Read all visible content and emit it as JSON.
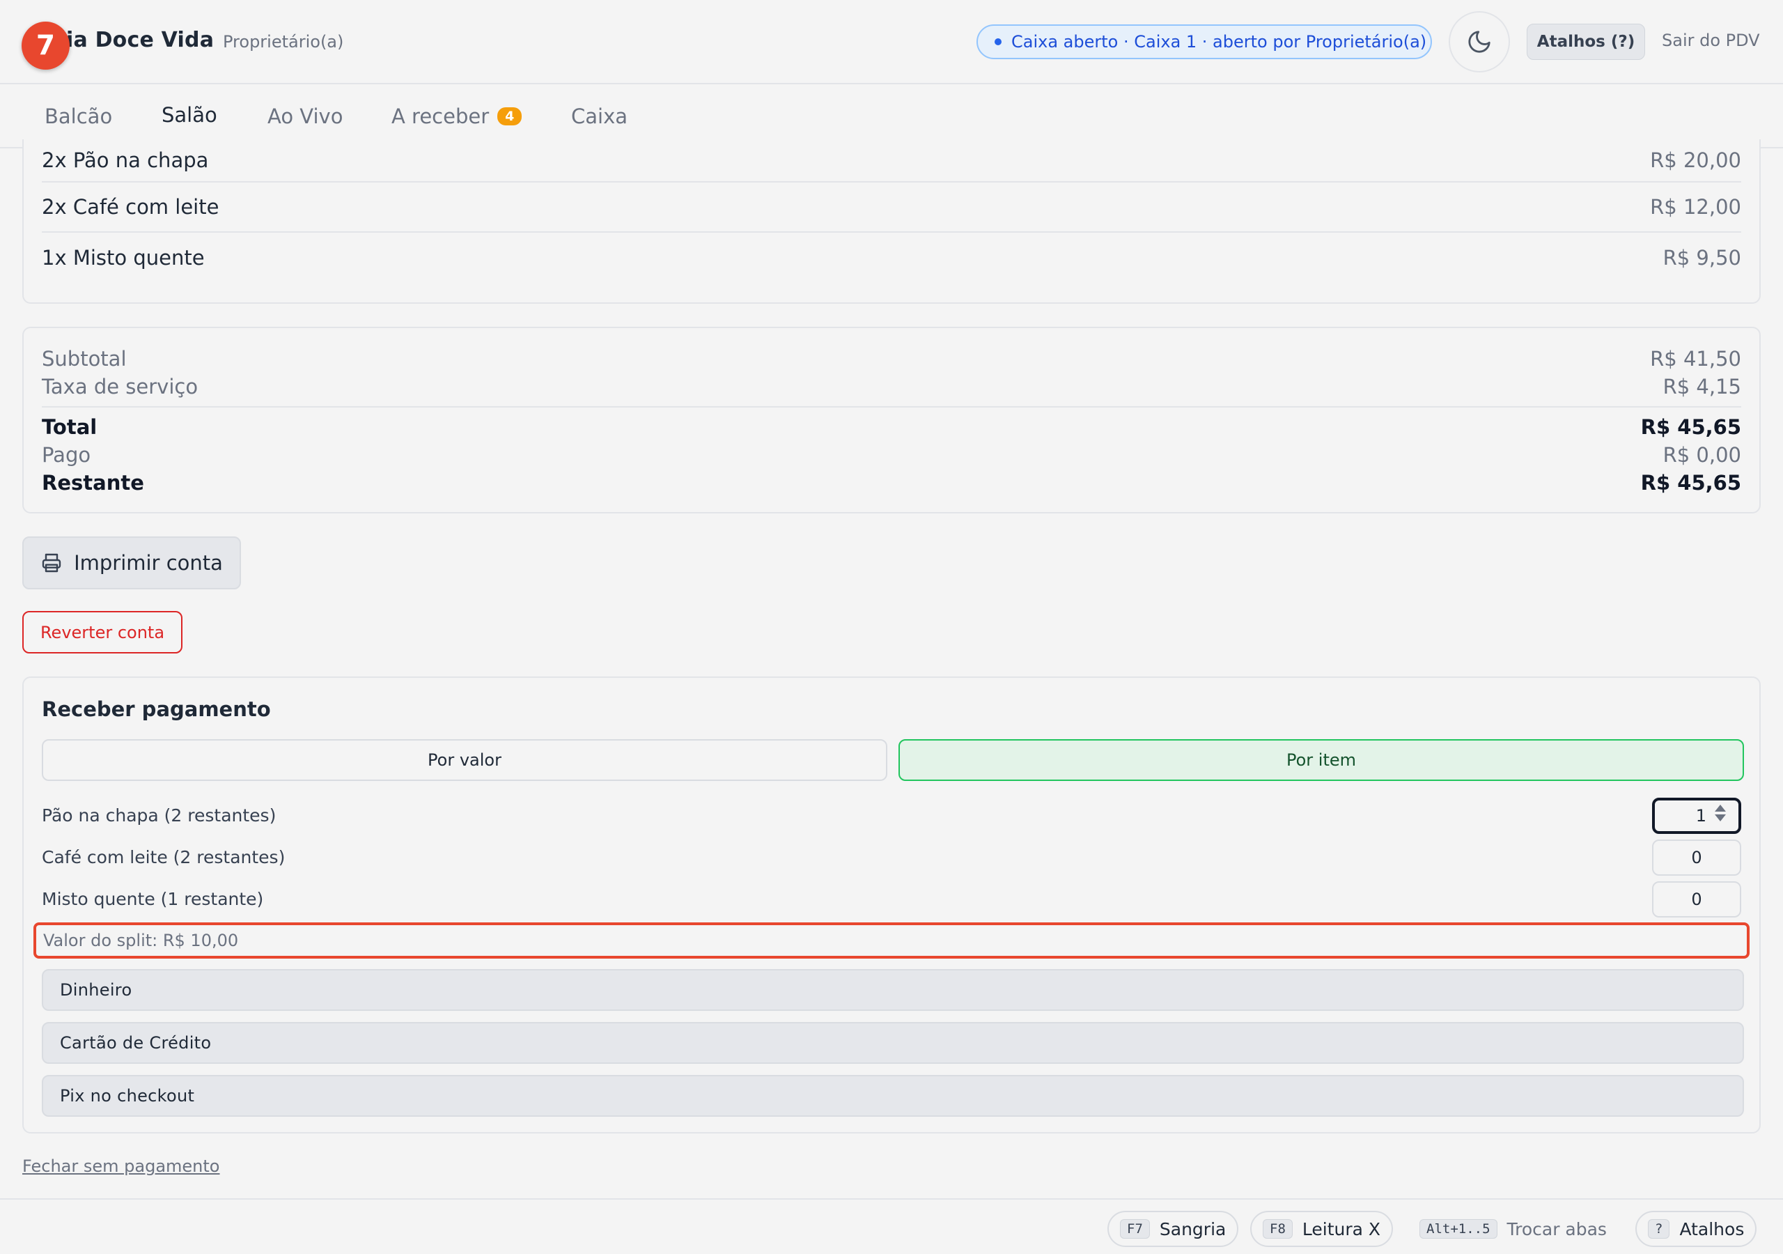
{
  "header": {
    "step_number": "7",
    "brand": "ria Doce Vida",
    "role": "Proprietário(a)",
    "status": "Caixa aberto · Caixa 1 · aberto por Proprietário(a)",
    "shortcuts_label": "Atalhos (?)",
    "exit_label": "Sair do PDV"
  },
  "tabs": [
    {
      "label": "Balcão"
    },
    {
      "label": "Salão",
      "active": true
    },
    {
      "label": "Ao Vivo"
    },
    {
      "label": "A receber",
      "count": "4"
    },
    {
      "label": "Caixa"
    }
  ],
  "order_items": [
    {
      "name": "2x Pão na chapa",
      "price": "R$ 20,00"
    },
    {
      "name": "2x Café com leite",
      "price": "R$ 12,00"
    },
    {
      "name": "1x Misto quente",
      "price": "R$ 9,50"
    }
  ],
  "summary": {
    "subtotal_label": "Subtotal",
    "subtotal": "R$ 41,50",
    "service_label": "Taxa de serviço",
    "service": "R$ 4,15",
    "total_label": "Total",
    "total": "R$ 45,65",
    "paid_label": "Pago",
    "paid": "R$ 0,00",
    "remaining_label": "Restante",
    "remaining": "R$ 45,65"
  },
  "actions": {
    "print_label": "Imprimir conta",
    "revert_label": "Reverter conta",
    "close_without_payment": "Fechar sem pagamento"
  },
  "payment": {
    "title": "Receber pagamento",
    "mode_value": "Por valor",
    "mode_item": "Por item",
    "active_mode": "Por item",
    "split_items": [
      {
        "label": "Pão na chapa (2 restantes)",
        "qty": "1"
      },
      {
        "label": "Café com leite (2 restantes)",
        "qty": "0"
      },
      {
        "label": "Misto quente (1 restante)",
        "qty": "0"
      }
    ],
    "split_value": "Valor do split: R$ 10,00",
    "methods": [
      "Dinheiro",
      "Cartão de Crédito",
      "Pix no checkout"
    ]
  },
  "footer": {
    "sangria_key": "F7",
    "sangria_label": "Sangria",
    "leitura_key": "F8",
    "leitura_label": "Leitura X",
    "tabs_key": "Alt+1..5",
    "tabs_label": "Trocar abas",
    "help_key": "?",
    "help_label": "Atalhos"
  },
  "colors": {
    "accent_green": "#16a34a",
    "danger_red": "#dc2626",
    "status_blue": "#1d4ed8",
    "badge_orange": "#f59e0b",
    "highlight": "#e8472e"
  },
  "icons": {
    "theme": "moon-icon",
    "print": "printer-icon"
  }
}
